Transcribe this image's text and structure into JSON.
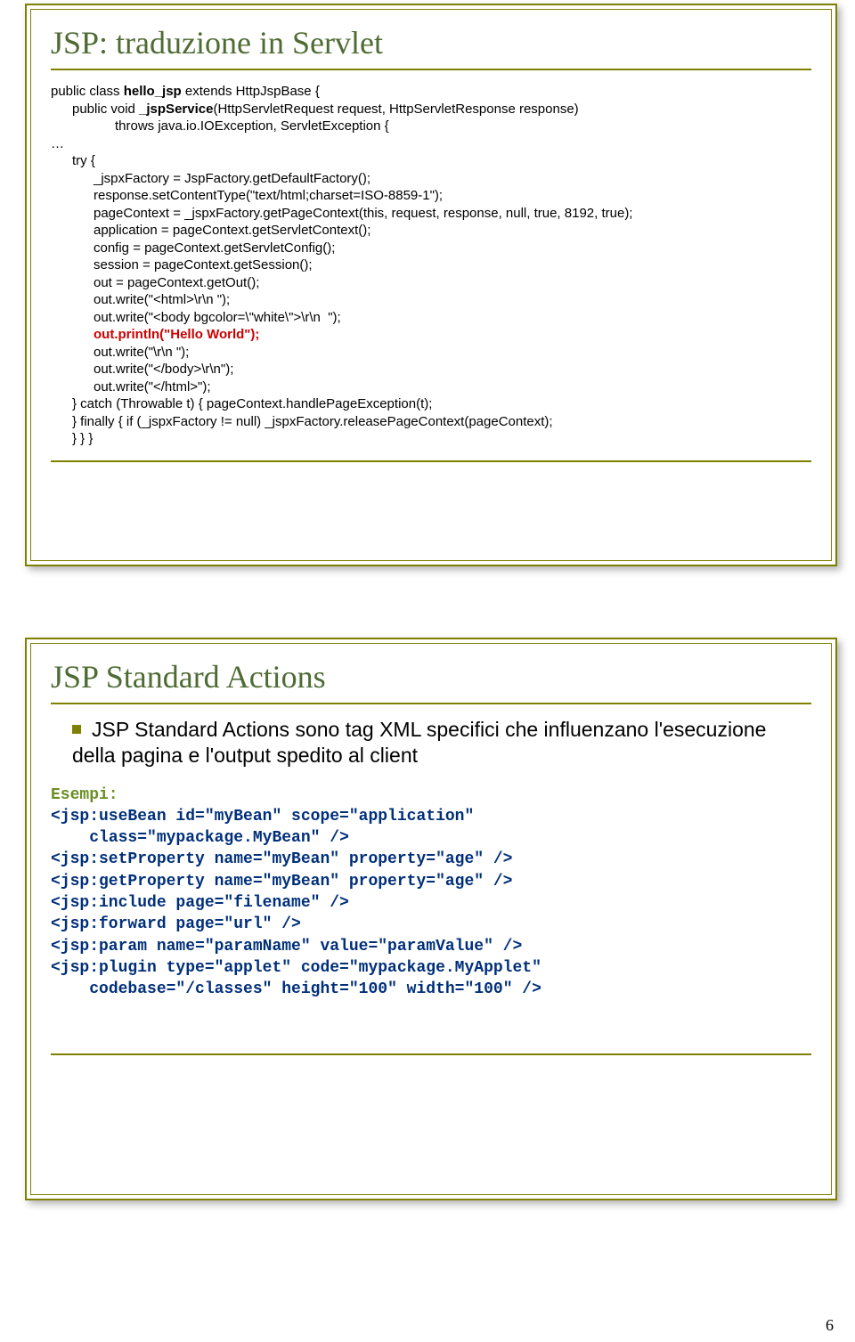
{
  "page": {
    "number": "6"
  },
  "slide1": {
    "title": "JSP: traduzione in Servlet",
    "code": {
      "l1": "public class ",
      "l1b": "hello_jsp",
      "l1c": " extends HttpJspBase {",
      "l2a": "public void ",
      "l2b": "_jspService",
      "l2c": "(HttpServletRequest request, HttpServletResponse response)",
      "l2d": "throws java.io.IOException, ServletException {",
      "l3": "…",
      "l4": "try {",
      "l5": "_jspxFactory = JspFactory.getDefaultFactory();",
      "l6": "response.setContentType(\"text/html;charset=ISO-8859-1\");",
      "l7": "pageContext = _jspxFactory.getPageContext(this, request, response, null, true, 8192, true);",
      "l8": "application = pageContext.getServletContext();",
      "l9": "config = pageContext.getServletConfig();",
      "l10": "session = pageContext.getSession();",
      "l11": "out = pageContext.getOut();",
      "l12": "out.write(\"<html>\\r\\n \");",
      "l13": "out.write(\"<body bgcolor=\\\"white\\\">\\r\\n  \");",
      "l14": "out.println(\"Hello World\");",
      "l15": "out.write(\"\\r\\n \");",
      "l16": "out.write(\"</body>\\r\\n\");",
      "l17": "out.write(\"</html>\");",
      "l18": "} catch (Throwable t) { pageContext.handlePageException(t);",
      "l19": "} finally { if (_jspxFactory != null) _jspxFactory.releasePageContext(pageContext);",
      "l20": "} } }"
    }
  },
  "slide2": {
    "title": "JSP Standard Actions",
    "body": "JSP Standard Actions sono tag XML specifici che influenzano l'esecuzione della pagina e l'output spedito al client",
    "esempi_label": "Esempi:",
    "ex": {
      "l1": "<jsp:useBean id=\"myBean\" scope=\"application\"",
      "l1b": "    class=\"mypackage.MyBean\" />",
      "l2": "<jsp:setProperty name=\"myBean\" property=\"age\" />",
      "l3": "<jsp:getProperty name=\"myBean\" property=\"age\" />",
      "l4": "<jsp:include page=\"filename\" />",
      "l5": "<jsp:forward page=\"url\" />",
      "l6": "<jsp:param name=\"paramName\" value=\"paramValue\" />",
      "l7": "<jsp:plugin type=\"applet\" code=\"mypackage.MyApplet\"",
      "l7b": "    codebase=\"/classes\" height=\"100\" width=\"100\" />"
    }
  }
}
